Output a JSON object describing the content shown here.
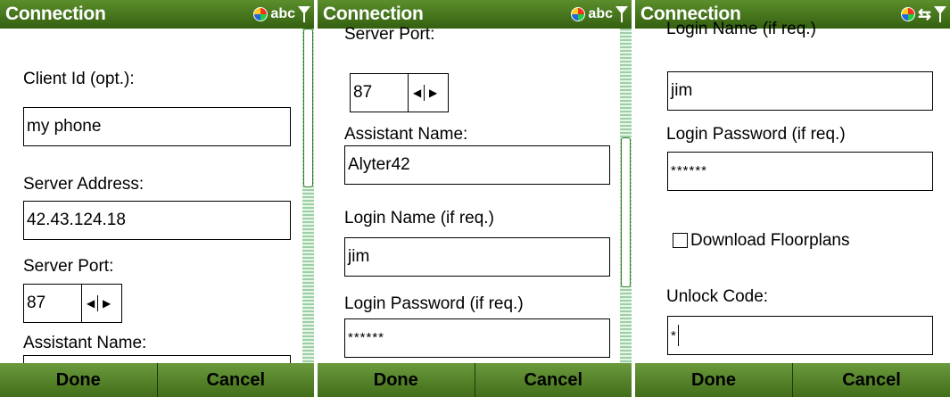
{
  "colors": {
    "title_bar": "#4a7d1e",
    "soft_key_bar": "#5a8a2e",
    "scrollbar_track": "#9bd0a4",
    "scrollbar_thumb_border": "#2e7d2a"
  },
  "screens": [
    {
      "title": "Connection",
      "status_icons": [
        "network-globe-icon",
        "abc",
        "signal-antenna-icon"
      ],
      "status_text": "abc",
      "labels": {
        "client_id": "Client Id (opt.):",
        "server_address": "Server Address:",
        "server_port": "Server Port:",
        "assistant_name": "Assistant Name:"
      },
      "values": {
        "client_id": "my phone",
        "server_address": "42.43.124.18",
        "server_port": "87"
      },
      "softkeys": {
        "left": "Done",
        "right": "Cancel"
      }
    },
    {
      "title": "Connection",
      "status_icons": [
        "network-globe-icon",
        "abc",
        "signal-antenna-icon"
      ],
      "status_text": "abc",
      "labels": {
        "server_port": "Server Port:",
        "assistant_name": "Assistant Name:",
        "login_name": "Login Name (if req.)",
        "login_password": "Login Password (if req.)"
      },
      "values": {
        "server_port": "87",
        "assistant_name": "Alyter42",
        "login_name": "jim",
        "login_password": "******"
      },
      "softkeys": {
        "left": "Done",
        "right": "Cancel"
      }
    },
    {
      "title": "Connection",
      "status_icons": [
        "network-globe-icon",
        "data-connection-arrows-icon",
        "signal-antenna-icon"
      ],
      "labels": {
        "login_name": "Login Name (if req.)",
        "login_password": "Login Password (if req.)",
        "download_floorplans": "Download Floorplans",
        "unlock_code": "Unlock Code:"
      },
      "values": {
        "login_name": "jim",
        "login_password": "******",
        "download_floorplans_checked": false,
        "unlock_code": "*"
      },
      "softkeys": {
        "left": "Done",
        "right": "Cancel"
      }
    }
  ],
  "arrows": {
    "left": "◀",
    "right": "▶",
    "connection": "⇆"
  }
}
